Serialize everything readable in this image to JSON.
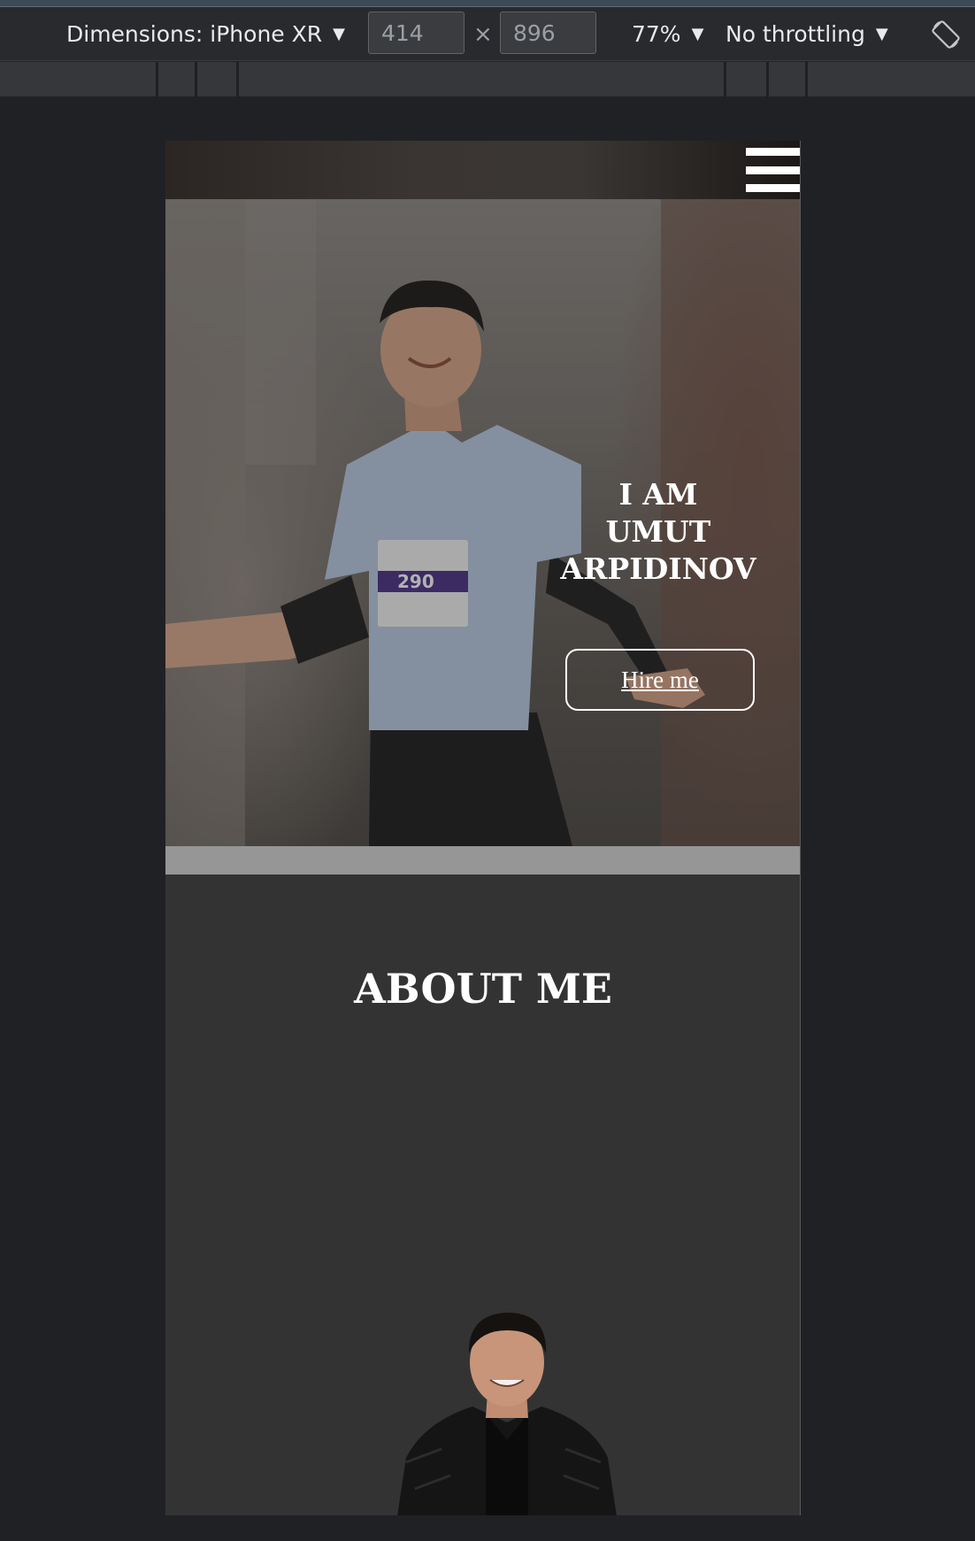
{
  "devtools": {
    "device_label": "Dimensions: iPhone XR",
    "width_value": "414",
    "height_value": "896",
    "times_glyph": "×",
    "zoom": "77%",
    "throttling": "No throttling",
    "caret": "▼"
  },
  "page": {
    "hero": {
      "title_line1": "I AM",
      "title_line2": "UMUT",
      "title_line3": "ARPIDINOV",
      "hire_button": "Hire me"
    },
    "about": {
      "title": "ABOUT ME"
    }
  },
  "colors": {
    "page_background": "#333333",
    "band": "#969696",
    "text": "#ffffff"
  }
}
